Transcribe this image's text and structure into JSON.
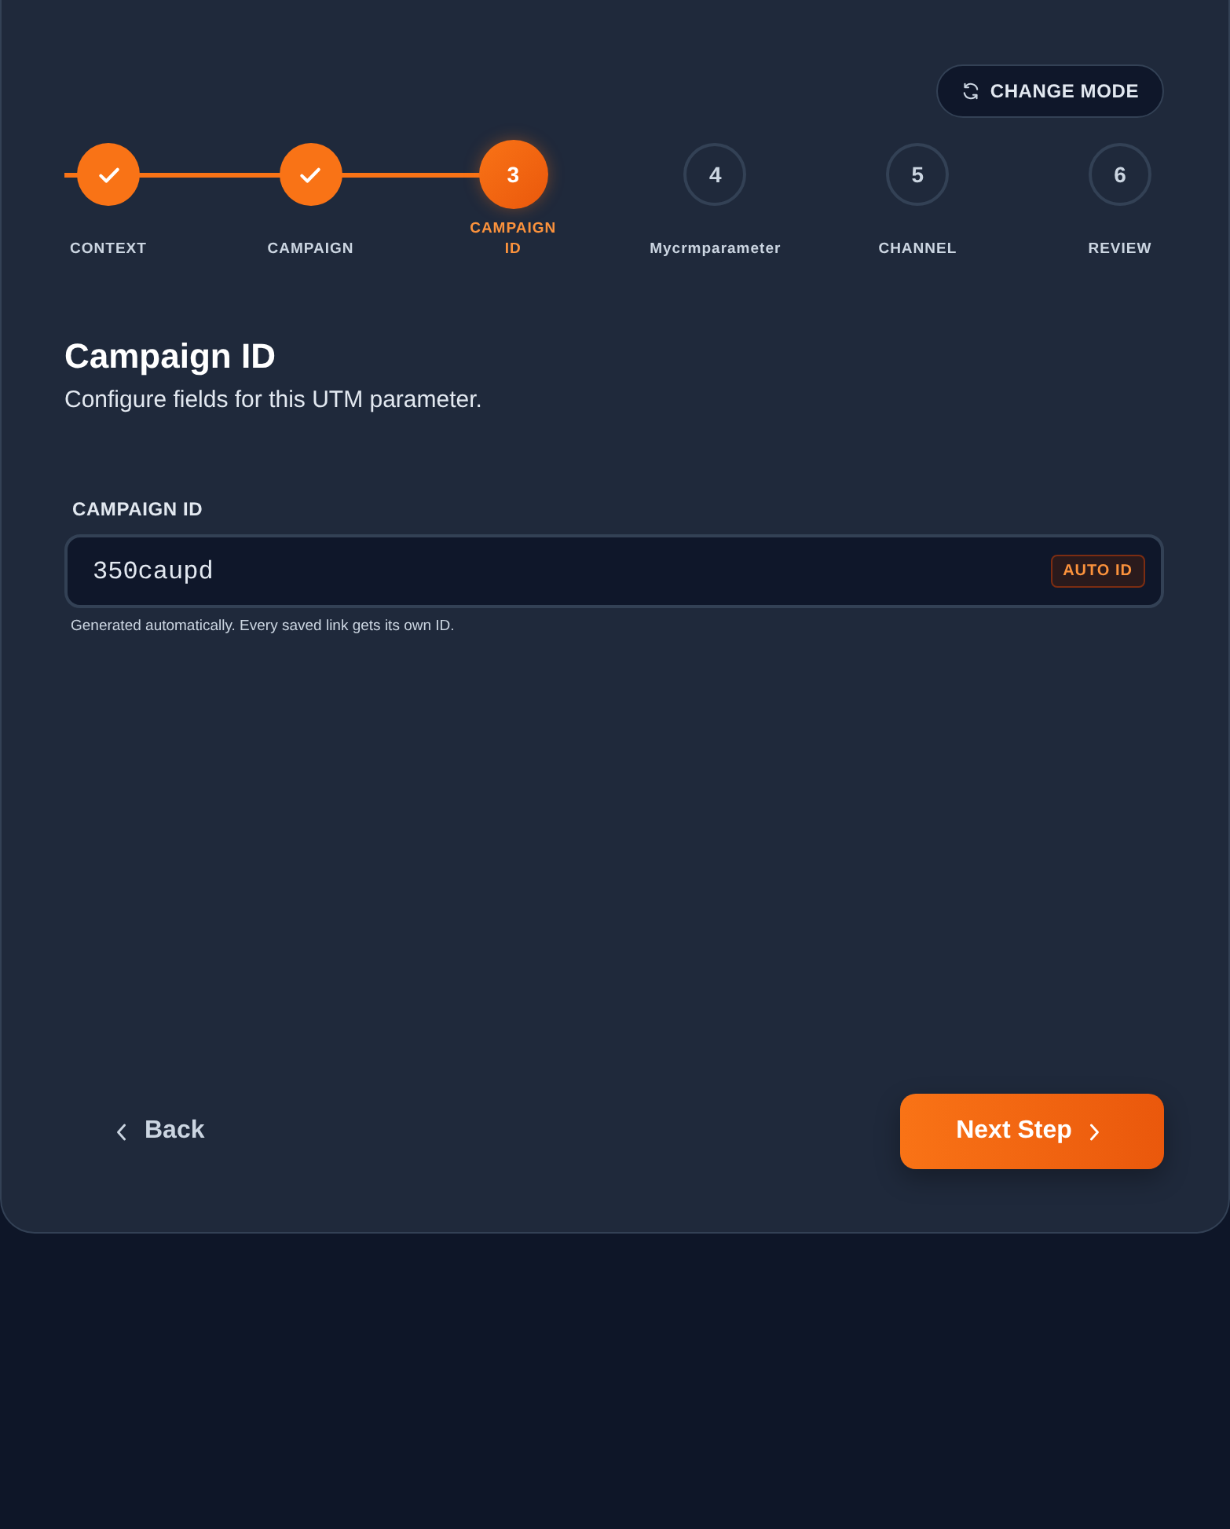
{
  "header": {
    "mode_button": "CHANGE MODE"
  },
  "steps": [
    {
      "label": "CONTEXT",
      "completed": true,
      "selected": false
    },
    {
      "label": "CAMPAIGN",
      "completed": true,
      "selected": false
    },
    {
      "number": "3",
      "label": "CAMPAIGN ID",
      "completed": false,
      "selected": true
    },
    {
      "number": "4",
      "label": "Mycrmparameter",
      "completed": false,
      "selected": false
    },
    {
      "number": "5",
      "label": "CHANNEL",
      "completed": false,
      "selected": false
    },
    {
      "number": "6",
      "label": "REVIEW",
      "completed": false,
      "selected": false
    }
  ],
  "section": {
    "title": "Campaign ID",
    "subtitle": "Configure fields for this UTM parameter."
  },
  "field": {
    "label": "CAMPAIGN ID",
    "value": "350caupd",
    "badge": "AUTO ID",
    "helper": "Generated automatically. Every saved link gets its own ID."
  },
  "footer": {
    "back": "Back",
    "next": "Next Step"
  }
}
